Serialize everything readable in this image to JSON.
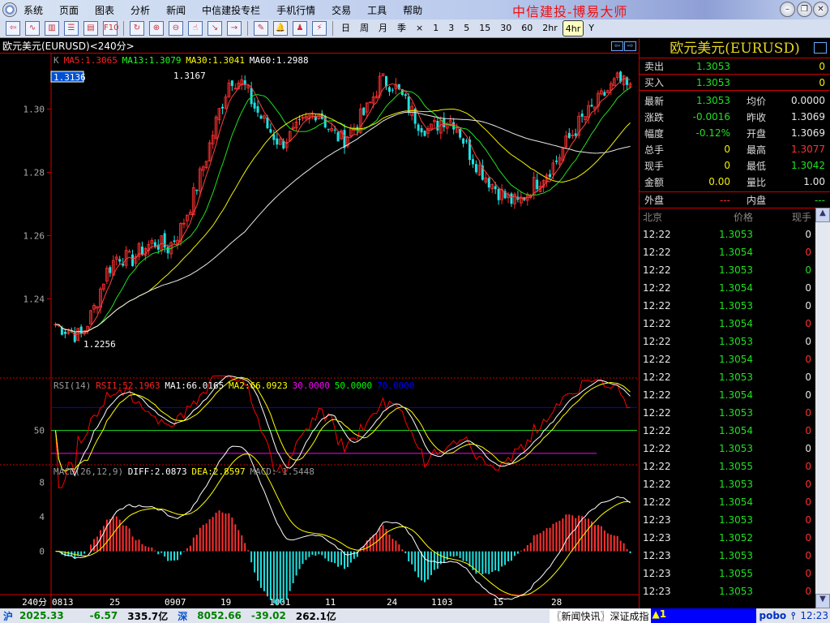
{
  "menu": {
    "items": [
      "系统",
      "页面",
      "图表",
      "分析",
      "新闻",
      "中信建投专栏",
      "手机行情",
      "交易",
      "工具",
      "帮助"
    ],
    "brand": "中信建投-博易大师"
  },
  "window_buttons": {
    "minimize": "–",
    "restore": "❐",
    "close": "✕"
  },
  "toolbar": {
    "icons": [
      "back-icon",
      "line-chart-icon",
      "kline-icon",
      "list-icon",
      "report-icon",
      "f10-icon",
      "refresh-icon",
      "zoom-in-icon",
      "zoom-out-icon",
      "select-icon",
      "export-icon",
      "import-icon",
      "draw-icon",
      "alarm-icon",
      "users-icon",
      "flash-icon"
    ],
    "periods": [
      "日",
      "周",
      "月",
      "季",
      "×",
      "1",
      "3",
      "5",
      "15",
      "30",
      "60",
      "2hr",
      "4hr",
      "Y"
    ],
    "active_period": "4hr"
  },
  "chart_header": {
    "title": "欧元美元(EURUSD)<240分>",
    "prev": "⇦",
    "next": "⇨"
  },
  "chart_data": [
    {
      "type": "candlestick",
      "name": "price",
      "legend": {
        "k": "K",
        "ma5": "MA5:1.3065",
        "ma13": "MA13:1.3079",
        "ma30": "MA30:1.3041",
        "ma60": "MA60:1.2988"
      },
      "cursor_price": "1.3136",
      "high_label": "1.3167",
      "low_label": "1.2256",
      "y_ticks": [
        "1.24",
        "1.26",
        "1.28",
        "1.30"
      ],
      "ylim": [
        1.215,
        1.317
      ],
      "anchors": [
        1.232,
        1.23,
        1.228,
        1.236,
        1.248,
        1.254,
        1.252,
        1.256,
        1.258,
        1.256,
        1.262,
        1.272,
        1.284,
        1.298,
        1.31,
        1.308,
        1.3,
        1.294,
        1.289,
        1.292,
        1.296,
        1.3,
        1.293,
        1.29,
        1.295,
        1.3,
        1.309,
        1.308,
        1.302,
        1.296,
        1.293,
        1.297,
        1.296,
        1.287,
        1.281,
        1.276,
        1.272,
        1.27,
        1.275,
        1.279,
        1.283,
        1.29,
        1.296,
        1.3,
        1.305,
        1.309,
        1.306
      ],
      "x_labels": [
        "240分",
        "0813",
        "25",
        "0907",
        "19",
        "1001",
        "11",
        "24",
        "1103",
        "15",
        "28"
      ]
    },
    {
      "type": "line",
      "name": "rsi",
      "legend": {
        "title": "RSI(14)",
        "rsi1": "RSI1:52.1963",
        "ma1": "MA1:66.0165",
        "ma2": "MA2:66.0923",
        "l30": "30.0000",
        "l50": "50.0000",
        "l70": "70.0000"
      },
      "y_ticks": [
        "50"
      ],
      "ylim": [
        20,
        95
      ]
    },
    {
      "type": "bar",
      "name": "macd",
      "legend": {
        "title": "MACD(26,12,9)",
        "diff": "DIFF:2.0873",
        "dea": "DEA:2.8597",
        "macd": "MACD:-1.5448"
      },
      "y_ticks": [
        "8",
        "4",
        "0"
      ],
      "ylim": [
        -5,
        10
      ]
    }
  ],
  "quote": {
    "title": "欧元美元(EURUSD)",
    "sell": {
      "label": "卖出",
      "price": "1.3053",
      "vol": "0"
    },
    "buy": {
      "label": "买入",
      "price": "1.3053",
      "vol": "0"
    },
    "rows": [
      {
        "l1": "最新",
        "v1": "1.3053",
        "c1": "g",
        "l2": "均价",
        "v2": "0.0000",
        "c2": "wt"
      },
      {
        "l1": "涨跌",
        "v1": "-0.0016",
        "c1": "g",
        "l2": "昨收",
        "v2": "1.3069",
        "c2": "wt"
      },
      {
        "l1": "幅度",
        "v1": "-0.12%",
        "c1": "g",
        "l2": "开盘",
        "v2": "1.3069",
        "c2": "wt"
      },
      {
        "l1": "总手",
        "v1": "0",
        "c1": "y",
        "l2": "最高",
        "v2": "1.3077",
        "c2": "r"
      },
      {
        "l1": "现手",
        "v1": "0",
        "c1": "y",
        "l2": "最低",
        "v2": "1.3042",
        "c2": "g"
      },
      {
        "l1": "金额",
        "v1": "0.00",
        "c1": "y",
        "l2": "量比",
        "v2": "1.00",
        "c2": "wt"
      }
    ],
    "outer": {
      "l1": "外盘",
      "v1": "---",
      "l2": "内盘",
      "v2": "---"
    }
  },
  "trades": {
    "headers": [
      "北京",
      "价格",
      "现手"
    ],
    "rows": [
      [
        "12:22",
        "1.3053",
        "0",
        "wt"
      ],
      [
        "12:22",
        "1.3054",
        "0",
        "r"
      ],
      [
        "12:22",
        "1.3053",
        "0",
        "g"
      ],
      [
        "12:22",
        "1.3054",
        "0",
        "wt"
      ],
      [
        "12:22",
        "1.3053",
        "0",
        "wt"
      ],
      [
        "12:22",
        "1.3054",
        "0",
        "r"
      ],
      [
        "12:22",
        "1.3053",
        "0",
        "wt"
      ],
      [
        "12:22",
        "1.3054",
        "0",
        "r"
      ],
      [
        "12:22",
        "1.3053",
        "0",
        "wt"
      ],
      [
        "12:22",
        "1.3054",
        "0",
        "wt"
      ],
      [
        "12:22",
        "1.3053",
        "0",
        "r"
      ],
      [
        "12:22",
        "1.3054",
        "0",
        "r"
      ],
      [
        "12:22",
        "1.3053",
        "0",
        "wt"
      ],
      [
        "12:22",
        "1.3055",
        "0",
        "r"
      ],
      [
        "12:22",
        "1.3053",
        "0",
        "r"
      ],
      [
        "12:22",
        "1.3054",
        "0",
        "r"
      ],
      [
        "12:23",
        "1.3053",
        "0",
        "r"
      ],
      [
        "12:23",
        "1.3052",
        "0",
        "r"
      ],
      [
        "12:23",
        "1.3053",
        "0",
        "r"
      ],
      [
        "12:23",
        "1.3055",
        "0",
        "r"
      ],
      [
        "12:23",
        "1.3053",
        "0",
        "r"
      ]
    ]
  },
  "status": {
    "sh_label": "沪",
    "sh_index": "2025.33",
    "sh_change": "-6.57",
    "sh_amount": "335.7亿",
    "sz_label": "深",
    "sz_index": "8052.66",
    "sz_change": "-39.02",
    "sz_amount": "262.1亿",
    "news": "〖新闻快讯〗深证成指",
    "alert": "▲1",
    "pobo": "pobo",
    "time": "12:23"
  }
}
